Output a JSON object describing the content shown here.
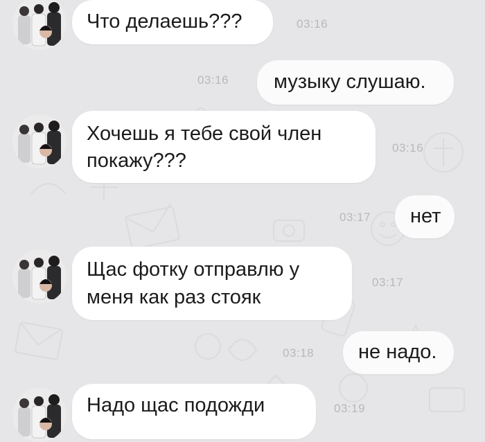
{
  "colors": {
    "background": "#e6e5e7",
    "incoming_bubble": "#ffffff",
    "outgoing_bubble": "#fbfbfb",
    "message_text": "#1b1b1d",
    "timestamp": "#b8b8ba"
  },
  "messages": [
    {
      "direction": "incoming",
      "lines": [
        "Что делаешь???"
      ],
      "time": "03:16"
    },
    {
      "direction": "outgoing",
      "lines": [
        "музыку слушаю."
      ],
      "time": "03:16"
    },
    {
      "direction": "incoming",
      "lines": [
        "Хочешь я тебе свой член",
        "покажу???"
      ],
      "time": "03:16"
    },
    {
      "direction": "outgoing",
      "lines": [
        "нет"
      ],
      "time": "03:17"
    },
    {
      "direction": "incoming",
      "lines": [
        "Щас фотку отправлю у",
        "меня как раз стояк"
      ],
      "time": "03:17"
    },
    {
      "direction": "outgoing",
      "lines": [
        "не надо."
      ],
      "time": "03:18"
    },
    {
      "direction": "incoming",
      "lines": [
        "Надо щас подожди"
      ],
      "time": "03:19"
    }
  ]
}
